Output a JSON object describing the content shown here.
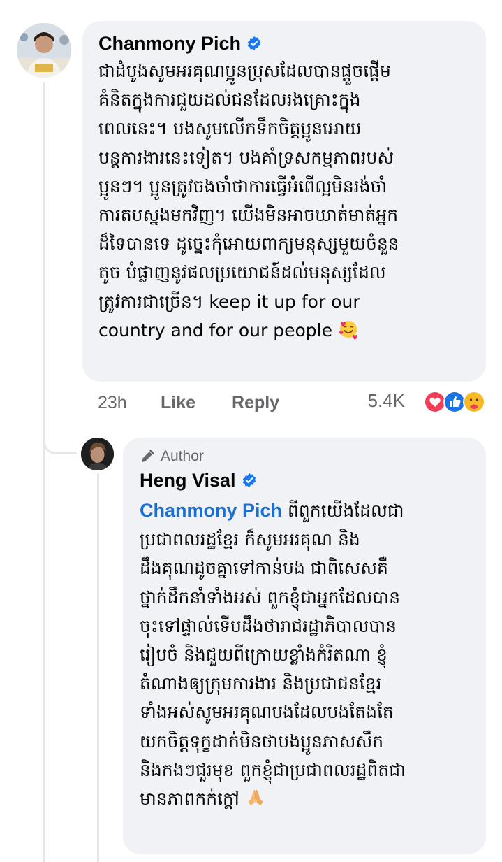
{
  "comment": {
    "author_name": "Chanmony Pich",
    "text_lines": [
      "ជាដំបូងសូមអរគុណប្អូនប្រុសដែលបានផ្តួចផ្តើម",
      "គំនិតក្នុងការជួយដល់ជនដែលរងគ្រោះក្នុង",
      "ពេលនេះ។ បងសូមលើកទឹកចិត្តប្អូនអោយ",
      "បន្តការងារនេះទៀត។ បងគាំទ្រសកម្មភាពរបស់",
      "ប្អូនៗ។ ប្អូនត្រូវចងចាំថាការធ្វើអំពើល្អមិនរង់ចាំ",
      "ការតបស្នងមកវិញ។ យើងមិនអាចឃាត់មាត់អ្នក",
      "ដ៏ទៃបានទេ ដូច្នេះកុំអោយពាក្យមនុស្សមួយចំនួន",
      "តូច បំផ្លាញនូវផលប្រយោជន៍ដល់មនុស្សដែល",
      "ត្រូវការជាច្រើន។ keep it up for our",
      "country and for our people"
    ],
    "time": "23h",
    "like_label": "Like",
    "reply_label": "Reply",
    "reaction_count": "5.4K",
    "reactions": [
      "love",
      "like",
      "care"
    ]
  },
  "reply": {
    "badge": "Author",
    "author_name": "Heng Visal",
    "mention": "Chanmony Pich",
    "first_line_rest": " ពីពួកយើងដែលជា",
    "text_lines": [
      "ប្រជាពលរដ្ឋខ្មែរ ក៏សូមអរគុណ និង",
      "ដឹងគុណដូចគ្នាទៅកាន់បង ជាពិសេសគឺ",
      "ថ្នាក់ដឹកនាំទាំងអស់ ពួកខ្ញុំជាអ្នកដែលបាន",
      "ចុះទៅផ្ទាល់ទើបដឹងថារាជរដ្ឋាភិបាលបាន",
      "រៀបចំ និងជួយពីក្រោយខ្លាំងកំរិតណា ខ្ញុំ",
      "តំណាងឲ្យក្រុមការងារ និងប្រជាជនខ្មែរ",
      "ទាំងអស់សូមអរគុណបងដែលបងតែងតែ",
      "យកចិត្តទុក្ខដាក់មិនថាបងប្អូនភាសសឹក",
      "និងកងៗជួរមុខ ពួកខ្ញុំជាប្រជាពលរដ្ឋពិតជា",
      "មានភាពកក់ក្តៅ"
    ]
  },
  "colors": {
    "link": "#1b6fd3",
    "bubble": "#f0f2f5",
    "muted": "#65676b",
    "verified": "#1877f2"
  }
}
